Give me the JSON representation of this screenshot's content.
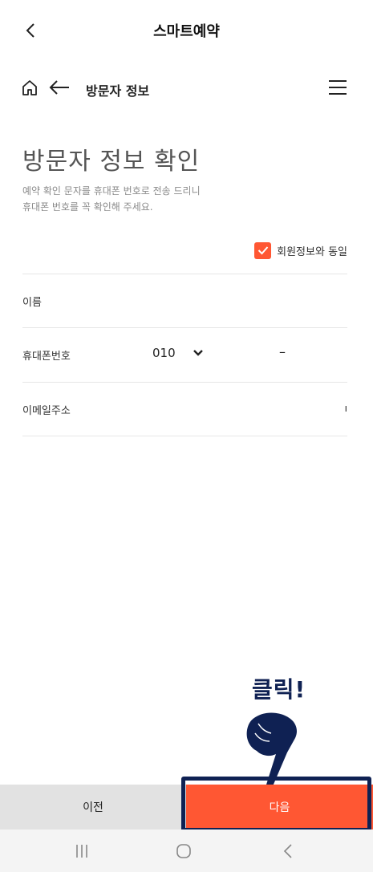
{
  "topbar": {
    "title": "스마트예약",
    "back_icon": "chevron-left-icon"
  },
  "subbar": {
    "title": "방문자 정보",
    "home_icon": "home-icon",
    "back_icon": "arrow-left-icon",
    "menu_icon": "hamburger-menu-icon"
  },
  "page": {
    "heading": "방문자 정보 확인",
    "description_line1": "예약 확인 문자를 휴대폰 번호로 전송 드리니",
    "description_line2": "휴대폰 번호를 꼭 확인해 주세요."
  },
  "same_as_member": {
    "label": "회원정보와 동일",
    "checked": true
  },
  "form": {
    "name_label": "이름",
    "phone_label": "휴대폰번호",
    "phone_prefix": "010",
    "phone_dash": "–",
    "email_label": "이메일주소",
    "email_tail": "ı"
  },
  "buttons": {
    "prev_label": "이전",
    "next_label": "다음"
  },
  "annotation": {
    "click_text": "클릭!"
  },
  "colors": {
    "accent": "#ff5733",
    "highlight": "#0f2153",
    "prev_bg": "#e2e2e2"
  },
  "navbar": {
    "recents_icon": "recents-icon",
    "home_icon": "home-circle-icon",
    "back_icon": "nav-back-icon"
  }
}
